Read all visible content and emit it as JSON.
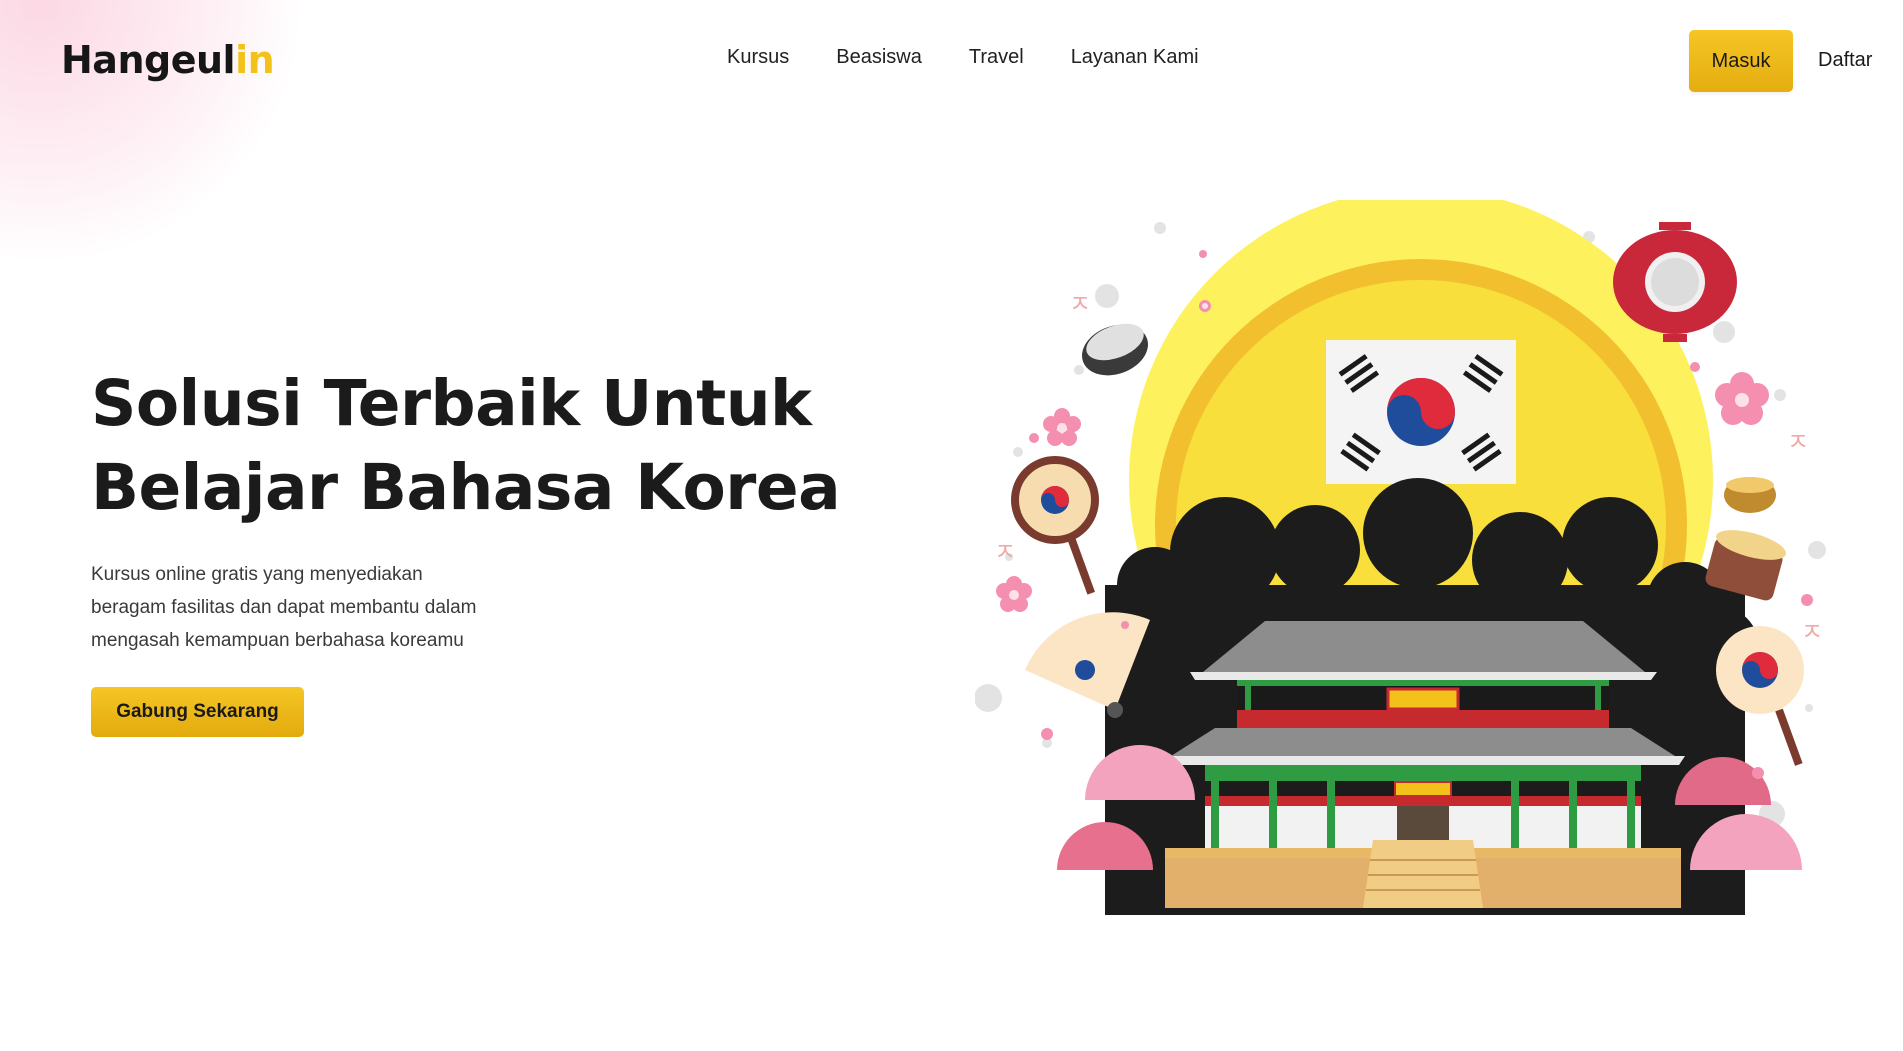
{
  "header": {
    "logo_main": "Hangeul",
    "logo_accent": "in",
    "nav": [
      {
        "label": "Kursus"
      },
      {
        "label": "Beasiswa"
      },
      {
        "label": "Travel"
      },
      {
        "label": "Layanan Kami"
      }
    ],
    "login_label": "Masuk",
    "register_label": "Daftar"
  },
  "hero": {
    "title_lines": [
      "Solusi Terbaik Untuk",
      "Belajar Bahasa Korea"
    ],
    "description_lines": [
      "Kursus online gratis yang menyediakan",
      "beragam fasilitas dan dapat membantu dalam",
      "mengasah kemampuan berbahasa koreamu"
    ],
    "cta_label": "Gabung Sekarang"
  },
  "illustration": {
    "glyph": "ㅈ",
    "colors": {
      "sun": "#fdf25e",
      "sun_ring": "#f2c02f",
      "hill": "#1c1c1c",
      "flag_red": "#e02b3c",
      "flag_blue": "#1f4d9c",
      "blossom": "#f58fb0",
      "roof": "#8a8a8a",
      "pillar": "#2f9c43",
      "beam": "#c72a2e",
      "base": "#e7b866",
      "brand_yellow": "#f2c21a"
    }
  }
}
